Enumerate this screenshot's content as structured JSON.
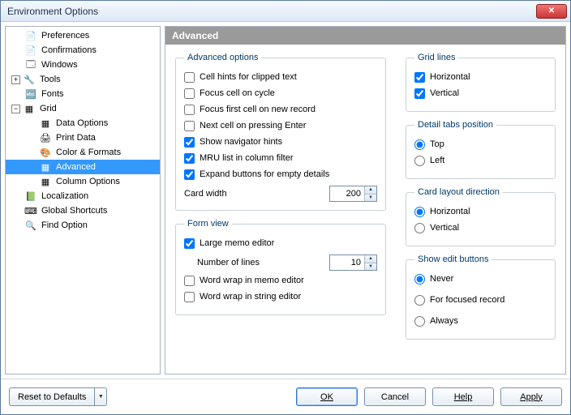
{
  "window": {
    "title": "Environment Options"
  },
  "tree": {
    "items": [
      {
        "label": "Preferences",
        "depth": 0,
        "expander": null,
        "icon": "📄"
      },
      {
        "label": "Confirmations",
        "depth": 0,
        "expander": null,
        "icon": "📄"
      },
      {
        "label": "Windows",
        "depth": 0,
        "expander": null,
        "icon": "🗔"
      },
      {
        "label": "Tools",
        "depth": 0,
        "expander": "+",
        "icon": "🔧"
      },
      {
        "label": "Fonts",
        "depth": 0,
        "expander": null,
        "icon": "🔤"
      },
      {
        "label": "Grid",
        "depth": 0,
        "expander": "−",
        "icon": "▦"
      },
      {
        "label": "Data Options",
        "depth": 1,
        "expander": null,
        "icon": "▦"
      },
      {
        "label": "Print Data",
        "depth": 1,
        "expander": null,
        "icon": "🖨"
      },
      {
        "label": "Color & Formats",
        "depth": 1,
        "expander": null,
        "icon": "🎨"
      },
      {
        "label": "Advanced",
        "depth": 1,
        "expander": null,
        "icon": "▦",
        "selected": true
      },
      {
        "label": "Column Options",
        "depth": 1,
        "expander": null,
        "icon": "▦"
      },
      {
        "label": "Localization",
        "depth": 0,
        "expander": null,
        "icon": "📗"
      },
      {
        "label": "Global Shortcuts",
        "depth": 0,
        "expander": null,
        "icon": "⌨"
      },
      {
        "label": "Find Option",
        "depth": 0,
        "expander": null,
        "icon": "🔍"
      }
    ]
  },
  "page": {
    "header": "Advanced",
    "advanced_options": {
      "legend": "Advanced options",
      "cell_hints": {
        "label": "Cell hints for clipped text",
        "checked": false
      },
      "focus_cycle": {
        "label": "Focus cell on cycle",
        "checked": false
      },
      "focus_new": {
        "label": "Focus first cell on new record",
        "checked": false
      },
      "next_enter": {
        "label": "Next cell on pressing Enter",
        "checked": false
      },
      "nav_hints": {
        "label": "Show navigator hints",
        "checked": true
      },
      "mru_filter": {
        "label": "MRU list in column filter",
        "checked": true
      },
      "expand_empty": {
        "label": "Expand buttons for empty details",
        "checked": true
      },
      "card_width_label": "Card width",
      "card_width_value": "200"
    },
    "form_view": {
      "legend": "Form view",
      "large_memo": {
        "label": "Large memo editor",
        "checked": true
      },
      "lines_label": "Number of lines",
      "lines_value": "10",
      "wrap_memo": {
        "label": "Word wrap in memo editor",
        "checked": false
      },
      "wrap_string": {
        "label": "Word wrap in string editor",
        "checked": false
      }
    },
    "grid_lines": {
      "legend": "Grid lines",
      "horizontal": {
        "label": "Horizontal",
        "checked": true
      },
      "vertical": {
        "label": "Vertical",
        "checked": true
      }
    },
    "detail_tabs": {
      "legend": "Detail tabs position",
      "top": {
        "label": "Top",
        "checked": true
      },
      "left": {
        "label": "Left",
        "checked": false
      }
    },
    "card_layout": {
      "legend": "Card layout direction",
      "horizontal": {
        "label": "Horizontal",
        "checked": true
      },
      "vertical": {
        "label": "Vertical",
        "checked": false
      }
    },
    "edit_buttons": {
      "legend": "Show edit buttons",
      "never": {
        "label": "Never",
        "checked": true
      },
      "focused": {
        "label": "For focused record",
        "checked": false
      },
      "always": {
        "label": "Always",
        "checked": false
      }
    }
  },
  "footer": {
    "reset": "Reset to Defaults",
    "ok": "OK",
    "cancel": "Cancel",
    "help": "Help",
    "apply": "Apply"
  }
}
